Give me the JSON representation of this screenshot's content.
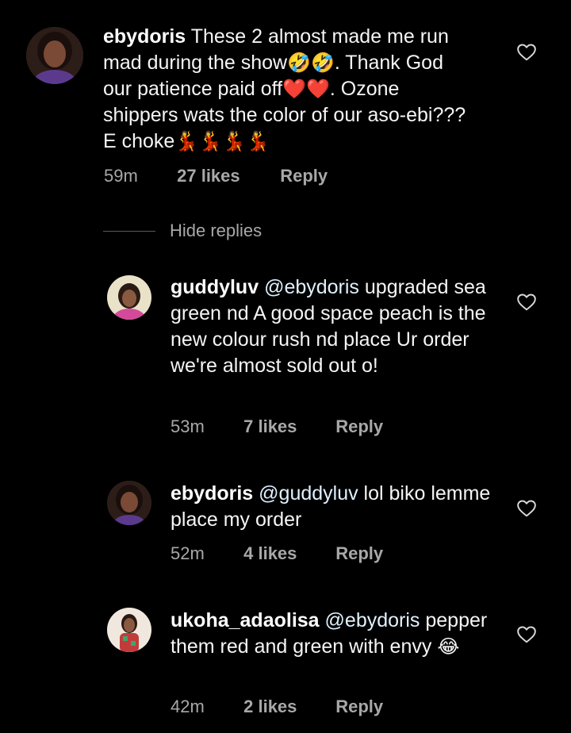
{
  "comments": [
    {
      "username": "ebydoris",
      "mention": "",
      "text": "These 2 almost made me run mad during the show",
      "text_emoji": "🤣🤣",
      "text_after": ". Thank God our patience paid off",
      "text_emoji2": "❤️❤️",
      "text_after2": ". Ozone shippers wats the color of our aso-ebi??? E choke",
      "text_emoji3": "💃💃💃💃",
      "time": "59m",
      "likes": "27 likes",
      "reply": "Reply"
    },
    {
      "username": "guddyluv",
      "mention": "@ebydoris",
      "text": " upgraded sea green nd A good space peach is the new colour rush nd place Ur order we're almost sold out o!",
      "time": "53m",
      "likes": "7 likes",
      "reply": "Reply"
    },
    {
      "username": "ebydoris",
      "mention": "@guddyluv",
      "text": " lol biko lemme place my order",
      "time": "52m",
      "likes": "4 likes",
      "reply": "Reply"
    },
    {
      "username": "ukoha_adaolisa",
      "mention": "@ebydoris",
      "text": " pepper them red and green with envy ",
      "text_emoji": "😂",
      "time": "42m",
      "likes": "2 likes",
      "reply": "Reply"
    }
  ],
  "thread": {
    "hide_replies_label": "Hide replies"
  },
  "icons": {
    "like": "heart-icon"
  },
  "colors": {
    "background": "#000000",
    "text": "#f5f5f5",
    "secondary": "#a8a8a8",
    "mention": "#e0f1ff"
  }
}
